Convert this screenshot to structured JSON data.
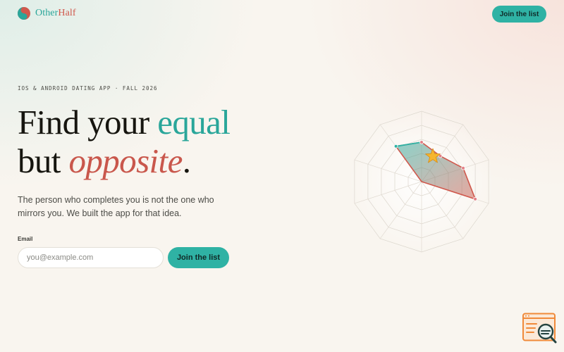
{
  "brand": {
    "name_part1": "Other",
    "name_part2": "Half",
    "logo_icon": "yin-yang-logo-icon"
  },
  "nav": {
    "cta_label": "Join the list"
  },
  "hero": {
    "eyebrow": "IOS & ANDROID DATING APP · FALL 2026",
    "headline_line1_pre": "Find your ",
    "headline_line1_accent": "equal",
    "headline_line2_pre": "but ",
    "headline_line2_accent": "opposite",
    "headline_line2_post": ".",
    "lede": "The person who completes you is not the one who mirrors you. We built the app for that idea."
  },
  "form": {
    "email_label": "Email",
    "email_placeholder": "you@example.com",
    "email_value": "",
    "submit_label": "Join the list"
  },
  "radar": {
    "axes": 10,
    "rings": 5,
    "values": [
      0.56,
      0.45,
      0.62,
      0.8,
      0,
      0,
      0,
      0,
      0,
      0.62
    ],
    "star_icon": "star-icon"
  },
  "colors": {
    "teal": "#2fb2a4",
    "coral": "#d0584c",
    "background": "#f9f5ef",
    "ink": "#16150f"
  },
  "corner_widget": {
    "icon": "search-window-icon"
  }
}
